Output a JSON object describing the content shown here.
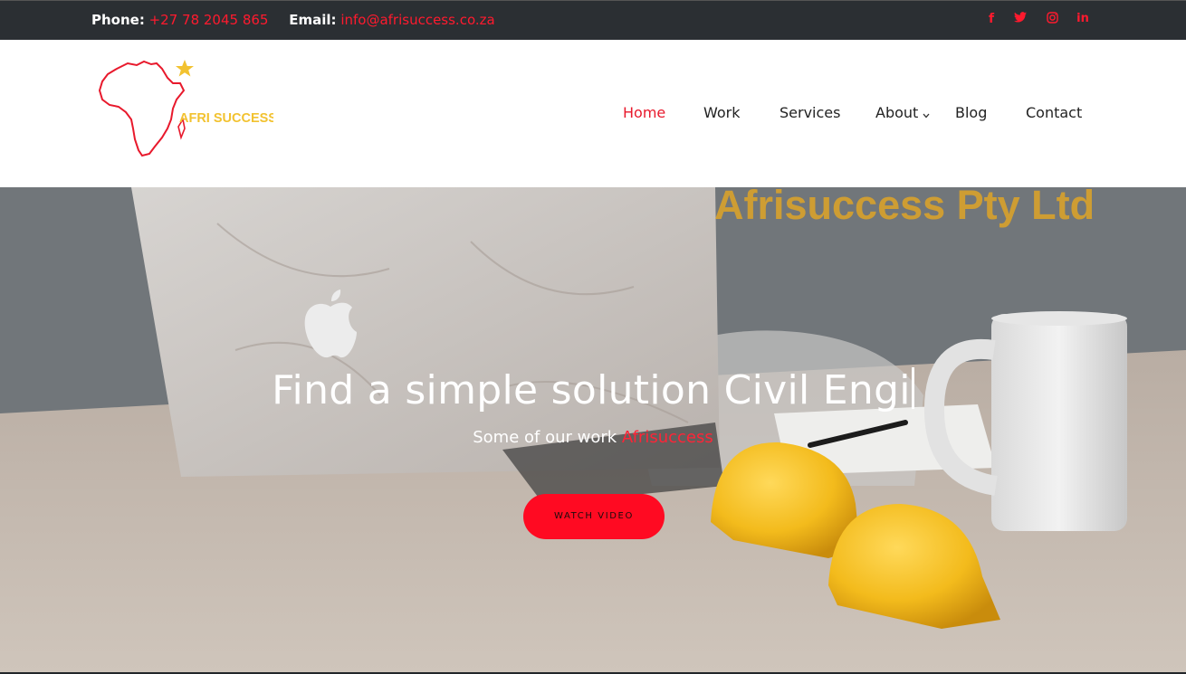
{
  "topbar": {
    "phone_label": "Phone:",
    "phone_value": "+27 78 2045 865",
    "email_label": "Email:",
    "email_value": "info@afrisuccess.co.za",
    "social_icons": [
      "facebook-icon",
      "twitter-icon",
      "instagram-icon",
      "linkedin-icon"
    ]
  },
  "logo": {
    "text": "AFRI SUCCESS"
  },
  "nav": {
    "items": [
      {
        "label": "Home",
        "active": true
      },
      {
        "label": "Work"
      },
      {
        "label": "Services"
      },
      {
        "label": "About",
        "has_dropdown": true
      },
      {
        "label": "Blog"
      },
      {
        "label": "Contact"
      }
    ]
  },
  "hero": {
    "company_text": "Afrisuccess Pty Ltd",
    "headline": "Find a simple solution Civil Engi",
    "subtitle_plain": "Some of our work",
    "subtitle_accent": "Afrisuccess",
    "button_label": "WATCH VIDEO"
  },
  "colors": {
    "accent": "#ff1a2e",
    "topbar_bg": "#2b2f33",
    "button_bg": "#ff0a22",
    "logo_yellow": "#f2c230"
  }
}
